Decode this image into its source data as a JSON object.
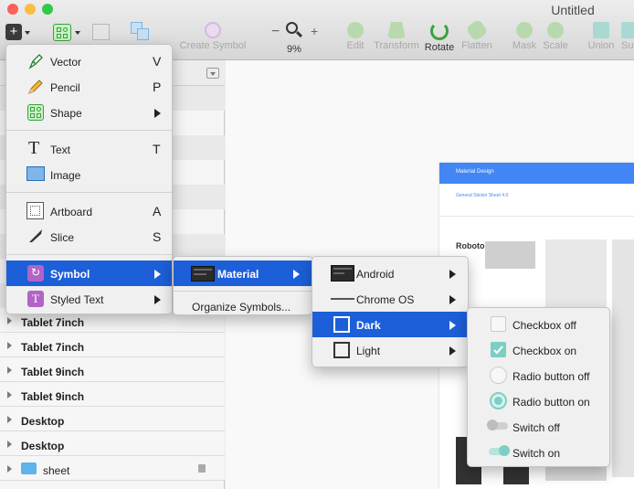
{
  "window": {
    "title": "Untitled"
  },
  "toolbar": {
    "items": [
      {
        "label": "Create Symbol"
      },
      {
        "label": "9%"
      },
      {
        "label": "Edit"
      },
      {
        "label": "Transform"
      },
      {
        "label": "Rotate"
      },
      {
        "label": "Flatten"
      },
      {
        "label": "Mask"
      },
      {
        "label": "Scale"
      },
      {
        "label": "Union"
      },
      {
        "label": "Su"
      }
    ]
  },
  "insert_menu": {
    "items": [
      {
        "label": "Vector",
        "key": "V"
      },
      {
        "label": "Pencil",
        "key": "P"
      },
      {
        "label": "Shape",
        "key": ""
      },
      {
        "label": "Text",
        "key": "T"
      },
      {
        "label": "Image",
        "key": ""
      },
      {
        "label": "Artboard",
        "key": "A"
      },
      {
        "label": "Slice",
        "key": "S"
      },
      {
        "label": "Symbol",
        "key": ""
      },
      {
        "label": "Styled Text",
        "key": ""
      }
    ]
  },
  "symbol_menu": {
    "items": [
      {
        "label": "Material"
      },
      {
        "label": "Organize Symbols..."
      }
    ]
  },
  "material_menu": {
    "items": [
      {
        "label": "Android"
      },
      {
        "label": "Chrome OS"
      },
      {
        "label": "Dark"
      },
      {
        "label": "Light"
      }
    ]
  },
  "dark_menu": {
    "items": [
      {
        "label": "Checkbox off"
      },
      {
        "label": "Checkbox on"
      },
      {
        "label": "Radio button off"
      },
      {
        "label": "Radio button on"
      },
      {
        "label": "Switch off"
      },
      {
        "label": "Switch on"
      }
    ]
  },
  "layers": {
    "rows": [
      {
        "label": "Tablet 7inch"
      },
      {
        "label": "Tablet 7inch"
      },
      {
        "label": "Tablet 9inch"
      },
      {
        "label": "Tablet 9inch"
      },
      {
        "label": "Desktop"
      },
      {
        "label": "Desktop"
      },
      {
        "label": "sheet"
      }
    ]
  },
  "artboard": {
    "header": "Material Design",
    "subtitle": "General Sticker Sheet 4.0",
    "sample_text": "Roboto"
  },
  "colors": {
    "selection": "#1c5fd8",
    "accent_teal": "#7ccfc4",
    "artboard_header": "#4285f4"
  }
}
